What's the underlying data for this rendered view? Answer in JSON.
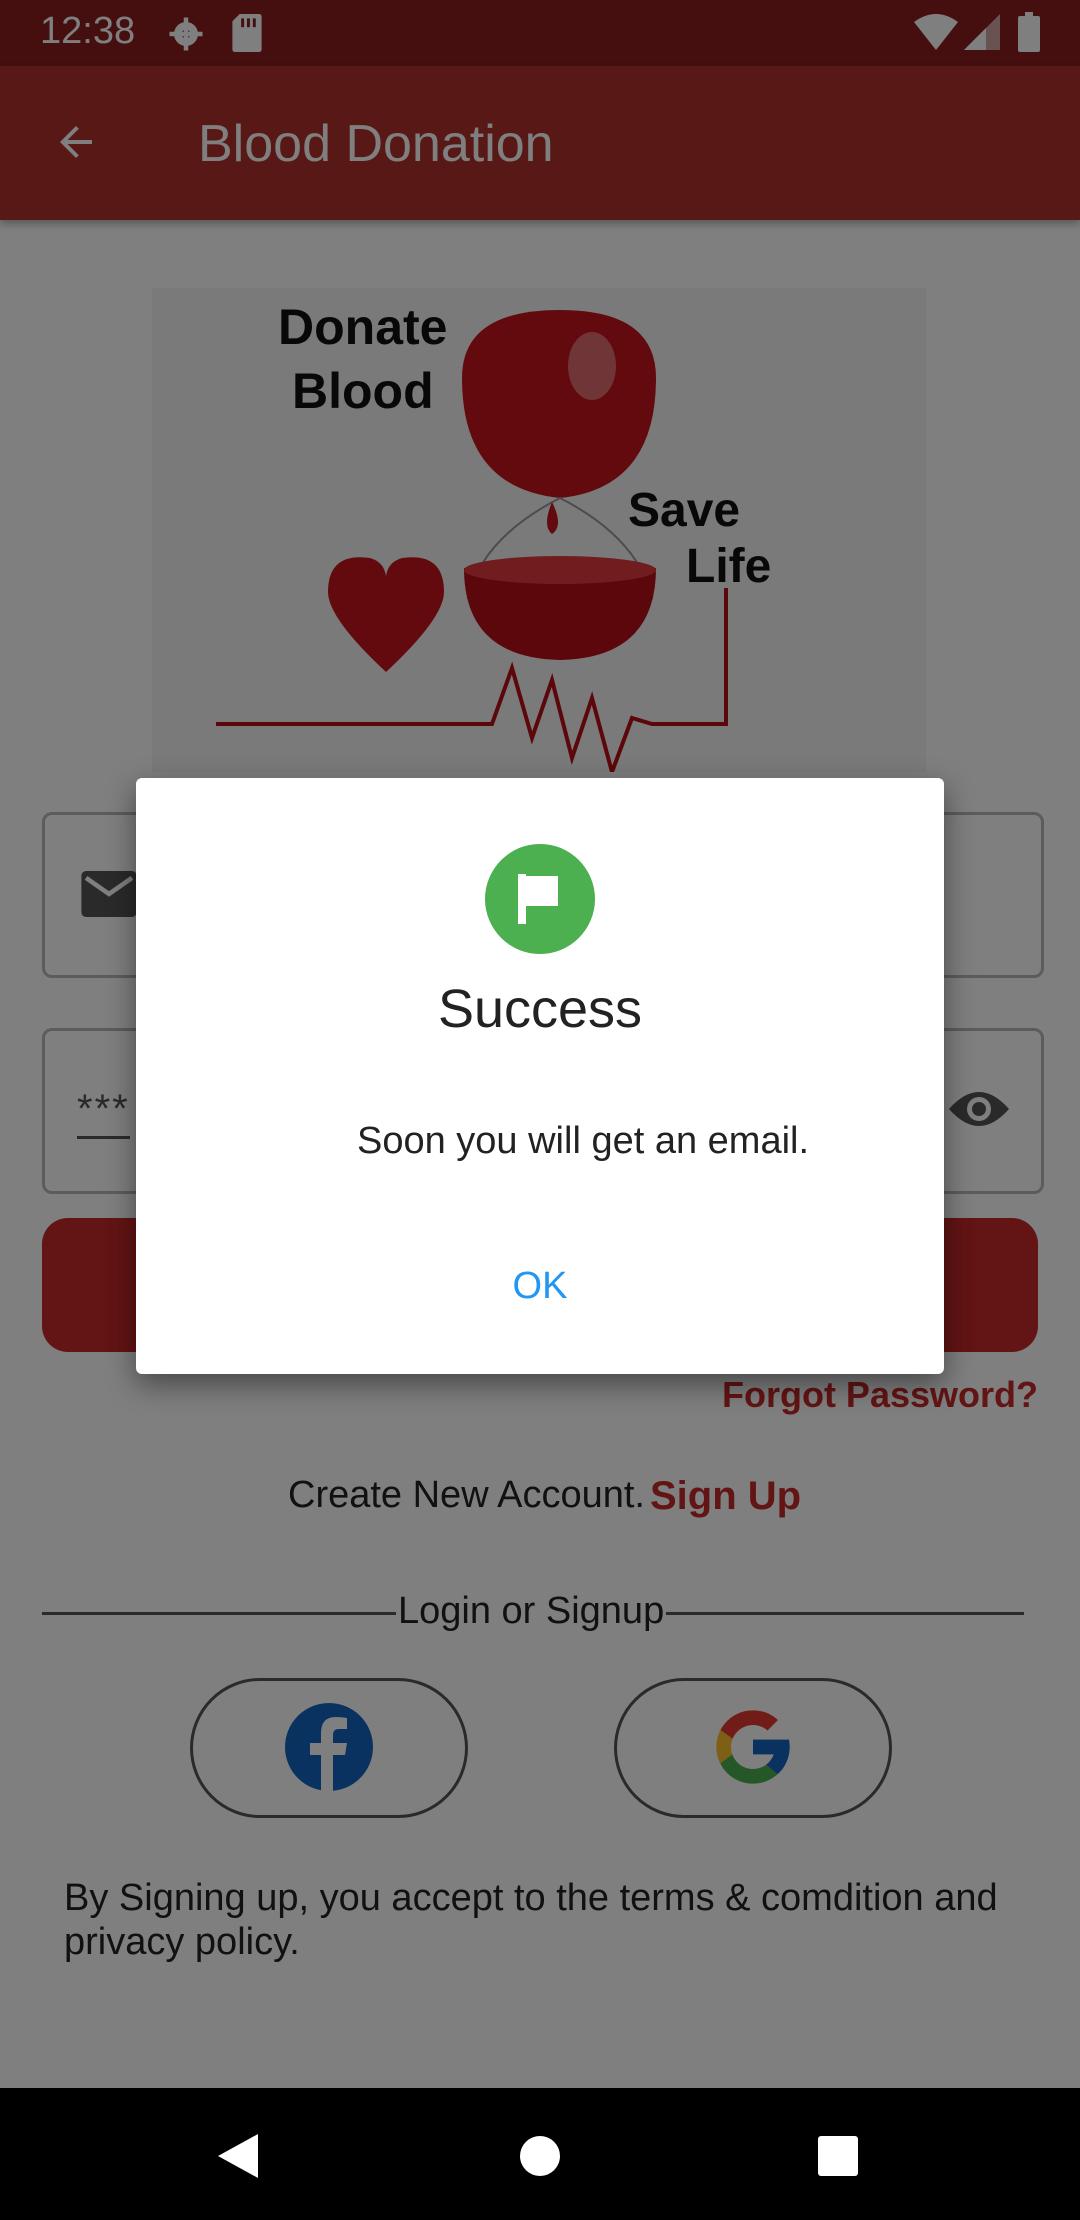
{
  "status_bar": {
    "time": "12:38",
    "icons": [
      "settings-icon",
      "sd-card-icon",
      "wifi-icon",
      "signal-icon",
      "battery-icon"
    ]
  },
  "app_bar": {
    "title": "Blood Donation",
    "back_icon": "arrow-back-icon"
  },
  "banner": {
    "line1": "Donate",
    "line2": "Blood",
    "line3": "Save",
    "line4": "Life"
  },
  "form": {
    "email_icon": "email-icon",
    "password_mask": "***",
    "visibility_icon": "eye-icon",
    "forgot_password": "Forgot Password?"
  },
  "account": {
    "create_text": "Create New Account.",
    "signup_link": "Sign Up"
  },
  "divider": {
    "label": "Login or Signup"
  },
  "social": {
    "facebook_icon": "facebook-icon",
    "google_icon": "google-icon"
  },
  "terms": "By Signing up, you accept to the terms & comdition and privacy policy.",
  "dialog": {
    "icon": "flag-icon",
    "title": "Success",
    "message": "Soon you will get an email.",
    "ok_label": "OK"
  },
  "nav_bar": {
    "icons": [
      "back-triangle-icon",
      "home-circle-icon",
      "recents-square-icon"
    ]
  },
  "colors": {
    "primary": "#c62828",
    "app_bar": "#b0302c",
    "success": "#4caf50",
    "dialog_button": "#2196f3"
  }
}
